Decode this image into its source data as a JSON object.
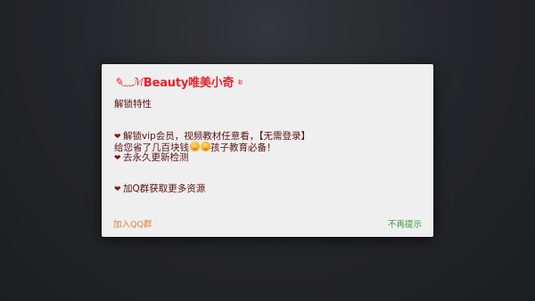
{
  "dialog": {
    "title_deco": "✎﹏ℳ",
    "title": "Beauty唯美小奇",
    "title_tail": "ะ",
    "section_heading": "解锁特性",
    "line1": "解锁vip会员，视频教材任意看，【无需登录】",
    "line2_prefix": "给您省了几百块钱",
    "line2_suffix": "孩子教育必备！",
    "line3": "去永久更新检测",
    "line4": "加Q群获取更多资源",
    "heart_icon": "heart-icon",
    "emoji_icon": "smiling-face-icon",
    "join_qq_label": "加入QQ群",
    "dismiss_label": "不再提示"
  },
  "colors": {
    "title": "#e8202a",
    "body": "#5a1010",
    "join": "#e07c3a",
    "dismiss": "#3c9a3c",
    "dialog_bg": "#efefef"
  }
}
